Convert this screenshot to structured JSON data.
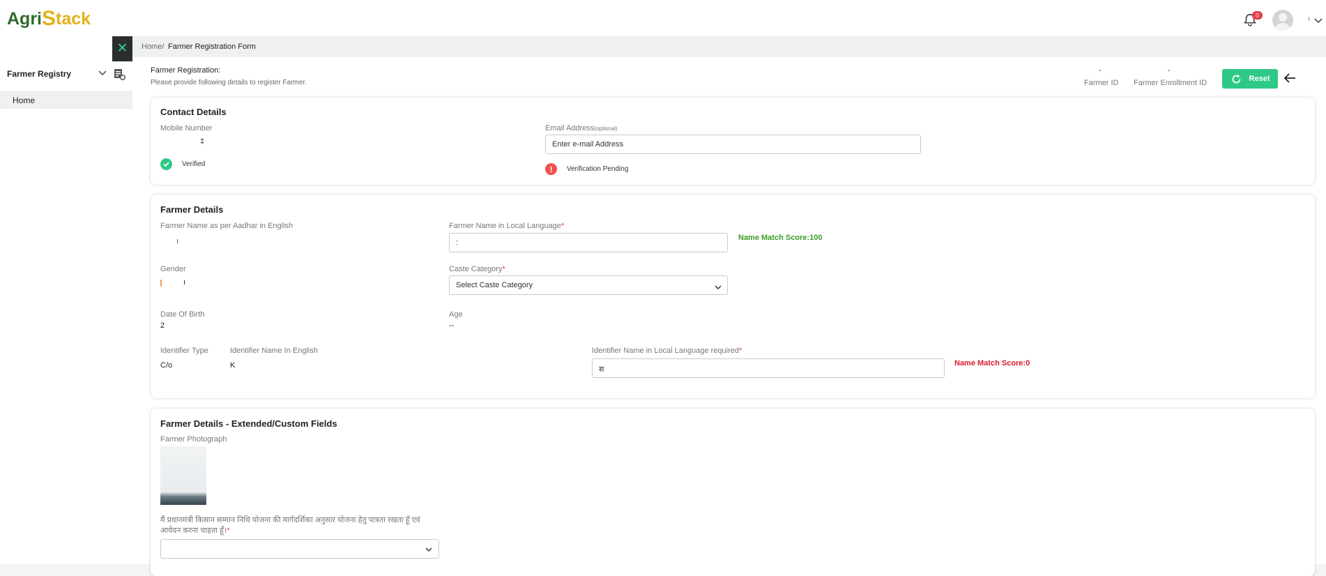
{
  "app": {
    "logo_text_1": "Agri",
    "logo_text_2": "S",
    "logo_text_3": "tack",
    "notification_count": "0",
    "user_name": "ı"
  },
  "sidebar": {
    "title": "Farmer Registry",
    "items": [
      {
        "label": "Home"
      }
    ]
  },
  "breadcrumb": {
    "home": "Home/",
    "current": "Farmer Registration Form"
  },
  "header": {
    "title": "Farmer Registration:",
    "subtitle": "Please provide following details to register Farmer.",
    "farmer_id_value": "-",
    "farmer_id_label": "Farmer ID",
    "enrollment_id_value": "-",
    "enrollment_id_label": "Farmer Enrollment ID",
    "reset_label": "Reset"
  },
  "contact": {
    "title": "Contact Details",
    "mobile_label": "Mobile Number",
    "mobile_value": "‡",
    "mobile_status": "Verified",
    "email_label": "Email Address",
    "email_optional": "(optional)",
    "email_placeholder": "Enter e-mail Address",
    "email_status": "Verification Pending"
  },
  "farmer": {
    "title": "Farmer Details",
    "name_en_label": "Farmer Name as per Aadhar in English",
    "name_en_value": "ı",
    "name_local_label": "Farmer Name in Local Language",
    "name_local_value": ":",
    "name_match": "Name Match Score:100",
    "gender_label": "Gender",
    "gender_value": "ı",
    "caste_label": "Caste Category",
    "caste_placeholder": "Select Caste Category",
    "dob_label": "Date Of Birth",
    "dob_value": "2",
    "age_label": "Age",
    "age_value": "--",
    "identifier_type_label": "Identifier Type",
    "identifier_type_value": "C/o",
    "identifier_name_en_label": "Identifier Name In English",
    "identifier_name_en_value": "K",
    "identifier_name_local_label": "Identifier Name in Local Language required",
    "identifier_name_local_value": "स",
    "identifier_match": "Name Match Score:0"
  },
  "extended": {
    "title": "Farmer Details - Extended/Custom Fields",
    "photo_label": "Farmer Photograph",
    "pm_kisan_question": "मैं प्रधानमंत्री किसान सम्मान निधि योजना की मार्गदर्शिका अनुसार योजना हेतु पात्रता रखता हूँ एवं आवेदन करना चाहता हूँ।",
    "pm_kisan_value": ""
  },
  "colors": {
    "accent": "#2fc987",
    "danger": "#e0172b",
    "success_text": "#3b9b25",
    "sidebar_dark": "#2b2e2f"
  }
}
